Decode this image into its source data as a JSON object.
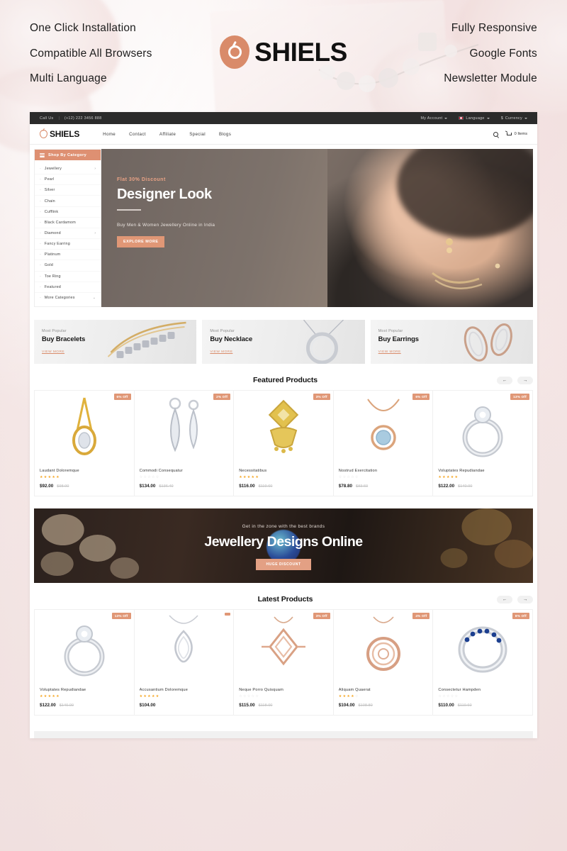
{
  "promo_header": {
    "left_features": [
      "One Click Installation",
      "Compatible All Browsers",
      "Multi Language"
    ],
    "right_features": [
      "Fully Responsive",
      "Google Fonts",
      "Newsletter Module"
    ],
    "brand": "SHIELS",
    "brand_color": "#d98b6a"
  },
  "site": {
    "topbar": {
      "call_label": "Call Us",
      "separator": "|",
      "phone": "(+12) 222 3456 888",
      "account": "My Account",
      "language": "Language",
      "currency_symbol": "$",
      "currency": "Currency"
    },
    "header": {
      "logo_text": "SHIELS",
      "nav": [
        "Home",
        "Contact",
        "Affiliate",
        "Special",
        "Blogs"
      ],
      "cart_text": "0 Items"
    },
    "hero": {
      "category_title": "Shop By Category",
      "categories": [
        {
          "label": "Jewellery",
          "arrow": "›"
        },
        {
          "label": "Pearl",
          "arrow": ""
        },
        {
          "label": "Silver",
          "arrow": ""
        },
        {
          "label": "Chain",
          "arrow": ""
        },
        {
          "label": "Cufflink",
          "arrow": ""
        },
        {
          "label": "Black Cardamom",
          "arrow": ""
        },
        {
          "label": "Diamond",
          "arrow": "›"
        },
        {
          "label": "Fancy Earring",
          "arrow": ""
        },
        {
          "label": "Platinum",
          "arrow": ""
        },
        {
          "label": "Gold",
          "arrow": ""
        },
        {
          "label": "Toe Ring",
          "arrow": ""
        },
        {
          "label": "Featured",
          "arrow": ""
        },
        {
          "label": "More Categories",
          "arrow": "⌄"
        }
      ],
      "eyebrow": "Flat 30% Discount",
      "title": "Designer Look",
      "description": "Buy Men & Women Jewellery Online in India",
      "button": "EXPLORE MORE"
    },
    "promos": [
      {
        "kicker": "Most Popular",
        "title": "Buy Bracelets",
        "link": "VIEW MORE"
      },
      {
        "kicker": "Most Popular",
        "title": "Buy Necklace",
        "link": "VIEW MORE"
      },
      {
        "kicker": "Most Popular",
        "title": "Buy Earrings",
        "link": "VIEW MORE"
      }
    ],
    "featured": {
      "title": "Featured Products",
      "prev_arrow": "←",
      "next_arrow": "→",
      "products": [
        {
          "name": "Laudant Doloremque",
          "badge": "6% Off",
          "rating": 5,
          "price": "$92.00",
          "old_price": "$98.00"
        },
        {
          "name": "Commodi Consequatur",
          "badge": "2% Off",
          "rating": 0,
          "price": "$134.00",
          "old_price": "$136.40"
        },
        {
          "name": "Necessitatibus",
          "badge": "3% Off",
          "rating": 5,
          "price": "$116.00",
          "old_price": "$119.60"
        },
        {
          "name": "Nostrud Exercitation",
          "badge": "6% Off",
          "rating": 0,
          "price": "$78.80",
          "old_price": "$83.60"
        },
        {
          "name": "Voluptates Repudiandae",
          "badge": "13% Off",
          "rating": 5,
          "price": "$122.00",
          "old_price": "$140.00"
        }
      ]
    },
    "mid_banner": {
      "kicker": "Get in the zone with the best brands",
      "title": "Jewellery Designs Online",
      "button": "HUGE DISCOUNT"
    },
    "latest": {
      "title": "Latest Products",
      "prev_arrow": "←",
      "next_arrow": "→",
      "products": [
        {
          "name": "Voluptates Repudiandae",
          "badge": "13% Off",
          "rating": 5,
          "price": "$122.00",
          "old_price": "$140.00"
        },
        {
          "name": "Accusantium Doloremque",
          "badge": "",
          "rating": 5,
          "price": "$104.00",
          "old_price": ""
        },
        {
          "name": "Neque Porro Quisquam",
          "badge": "3% Off",
          "rating": 0,
          "price": "$115.00",
          "old_price": "$118.00"
        },
        {
          "name": "Aliquam Quaerat",
          "badge": "4% Off",
          "rating": 4,
          "price": "$104.00",
          "old_price": "$108.80"
        },
        {
          "name": "Consectetur Hampden",
          "badge": "8% Off",
          "rating": 0,
          "price": "$110.00",
          "old_price": "$119.60"
        }
      ]
    }
  }
}
